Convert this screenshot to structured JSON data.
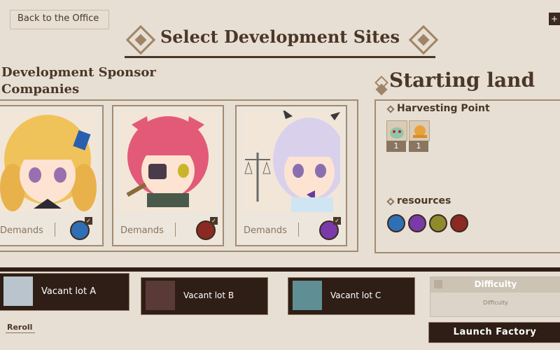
{
  "header": {
    "back_label": "Back to the Office",
    "plus_label": "+",
    "title": "Select Development Sites"
  },
  "sponsors": {
    "heading_line1": "Development Sponsor",
    "heading_line2": "Companies",
    "cards": [
      {
        "demands_label": "Demands",
        "resource_icon": "potion-icon",
        "resource_color": "#2f6fb5"
      },
      {
        "demands_label": "Demands",
        "resource_icon": "ember-icon",
        "resource_color": "#8a2a22"
      },
      {
        "demands_label": "Demands",
        "resource_icon": "gem-icon",
        "resource_color": "#7a3aa8"
      }
    ]
  },
  "starting_land": {
    "title": "Starting land",
    "harvesting_heading": "Harvesting Point",
    "harvest_points": [
      {
        "icon": "slime-icon",
        "count": "1"
      },
      {
        "icon": "snail-icon",
        "count": "1"
      }
    ],
    "resources_heading": "resources",
    "resources": [
      {
        "icon": "potion-icon",
        "color": "#2f6fb5"
      },
      {
        "icon": "gem-icon",
        "color": "#7a3aa8"
      },
      {
        "icon": "wheat-icon",
        "color": "#8f8a2c"
      },
      {
        "icon": "ember-icon",
        "color": "#8a2a22"
      }
    ]
  },
  "lots": [
    {
      "label": "Vacant lot A"
    },
    {
      "label": "Vacant lot B"
    },
    {
      "label": "Vacant lot C"
    }
  ],
  "difficulty": {
    "heading": "Difficulty",
    "sub": "Difficulty"
  },
  "reroll_label": "Reroll",
  "launch_label": "Launch Factory"
}
